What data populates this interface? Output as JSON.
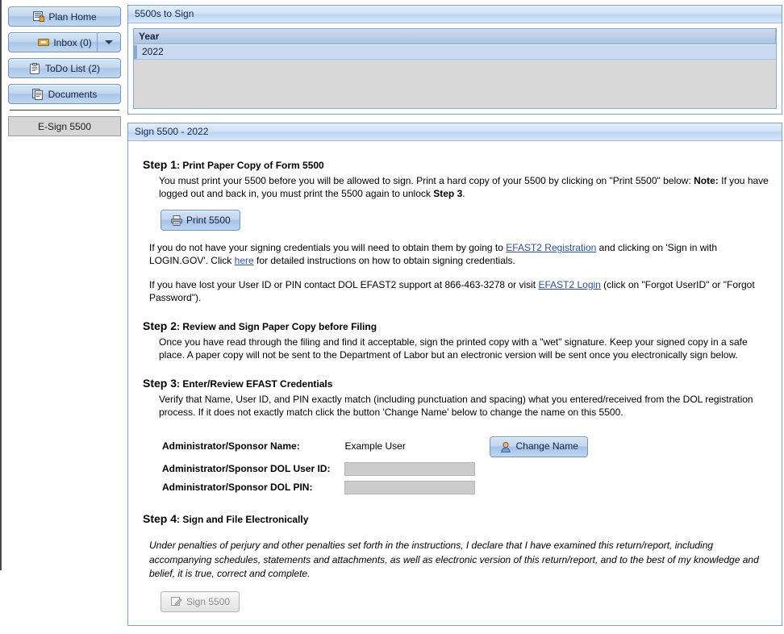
{
  "sidebar": {
    "items": [
      {
        "label": "Plan Home",
        "icon": "plan-home-icon",
        "has_dropdown": false
      },
      {
        "label": "Inbox (0)",
        "icon": "inbox-icon",
        "has_dropdown": true
      },
      {
        "label": "ToDo List (2)",
        "icon": "clipboard-icon",
        "has_dropdown": false
      },
      {
        "label": "Documents",
        "icon": "documents-icon",
        "has_dropdown": false
      }
    ],
    "active_tab": "E-Sign 5500"
  },
  "grid_panel": {
    "title": "5500s to Sign",
    "columns": [
      "Year"
    ],
    "rows": [
      [
        "2022"
      ]
    ]
  },
  "main_panel": {
    "title": "Sign 5500 - 2022",
    "steps": {
      "step1": {
        "number": "Step 1",
        "heading": ": Print Paper Copy of Form 5500",
        "body_1": "You must print your 5500 before you will be allowed to sign. Print a hard copy of your 5500 by clicking on \"Print 5500\" below: ",
        "body_note": "Note:",
        "body_2": " If you have logged out and back in, you must print the 5500 again to unlock ",
        "body_step3": "Step 3",
        "body_3": ".",
        "print_button": "Print 5500"
      },
      "credentials_para": {
        "text_1": "If you do not have your signing credentials you will need to obtain them by going to ",
        "link_1": "EFAST2 Registration",
        "text_2": " and clicking on 'Sign in with LOGIN.GOV'. Click ",
        "link_2": "here",
        "text_3": " for detailed instructions on how to obtain signing credentials."
      },
      "lost_para": {
        "text_1": "If you have lost your User ID or PIN contact DOL EFAST2 support at 866-463-3278 or visit ",
        "link_1": "EFAST2 Login",
        "text_2": " (click on \"Forgot UserID\" or \"Forgot Password\")."
      },
      "step2": {
        "number": "Step 2",
        "heading": ": Review and Sign Paper Copy before Filing",
        "body": "Once you have read through the filing and find it acceptable, sign the printed copy with a \"wet\" signature. Keep your signed copy in a safe place. A paper copy will not be sent to the Department of Labor but an electronic version will be sent once you electronically sign below."
      },
      "step3": {
        "number": "Step 3",
        "heading": ": Enter/Review EFAST Credentials",
        "body": "Verify that Name, User ID, and PIN exactly match (including punctuation and spacing) what you entered/received from the DOL registration process. If it does not exactly match click the button 'Change Name' below to change the name on this 5500.",
        "fields": [
          {
            "label": "Administrator/Sponsor Name:",
            "value": "Example User",
            "type": "text"
          },
          {
            "label": "Administrator/Sponsor DOL User ID:",
            "value": "",
            "type": "input"
          },
          {
            "label": "Administrator/Sponsor DOL PIN:",
            "value": "",
            "type": "input"
          }
        ],
        "change_name_button": "Change Name"
      },
      "step4": {
        "number": "Step 4",
        "heading": ": Sign and File Electronically",
        "perjury": "Under penalties of perjury and other penalties set forth in the instructions, I declare that I have examined this return/report, including accompanying schedules, statements and attachments, as well as electronic version of this return/report, and to the best of my knowledge and belief, it is true, correct and complete.",
        "sign_button": "Sign 5500"
      }
    }
  },
  "colors": {
    "panel_border": "#7b9ecb",
    "button_blue": "#c1d6f0",
    "link": "#2b4ea8",
    "grid_selected_row": "#c8daf2",
    "grid_empty_body": "#d8d8d8",
    "disabled_field": "#cccccc"
  }
}
